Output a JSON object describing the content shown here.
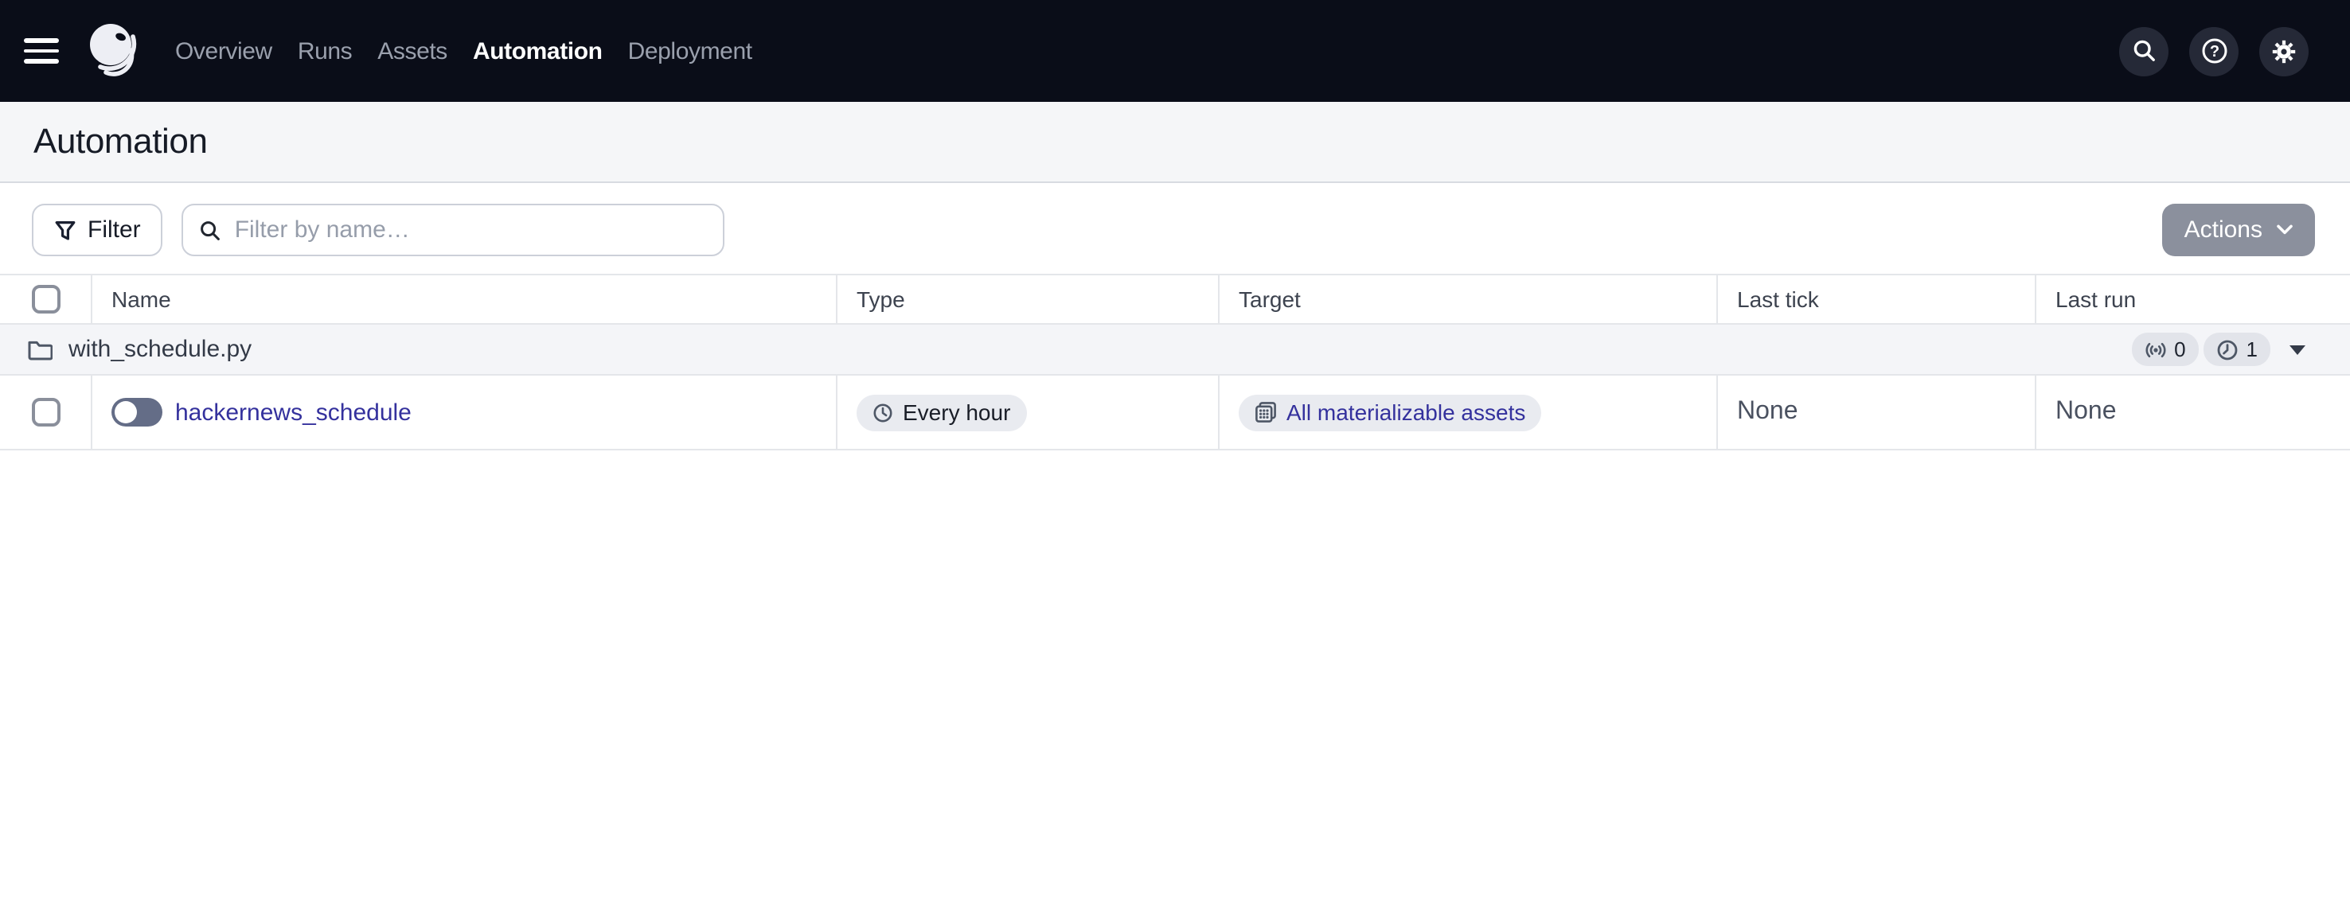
{
  "topbar": {
    "nav": [
      {
        "label": "Overview",
        "active": false
      },
      {
        "label": "Runs",
        "active": false
      },
      {
        "label": "Assets",
        "active": false
      },
      {
        "label": "Automation",
        "active": true
      },
      {
        "label": "Deployment",
        "active": false
      }
    ],
    "icons": [
      "hamburger-menu-icon",
      "dagster-logo",
      "search-icon",
      "help-icon",
      "settings-gear-icon"
    ],
    "help_glyph": "?"
  },
  "page": {
    "title": "Automation"
  },
  "toolbar": {
    "filter_button": "Filter",
    "search_placeholder": "Filter by name…",
    "search_value": "",
    "actions_button": "Actions"
  },
  "table": {
    "headers": [
      "Name",
      "Type",
      "Target",
      "Last tick",
      "Last run"
    ],
    "group_row": {
      "name": "with_schedule.py",
      "sensor_count": "0",
      "schedule_count": "1"
    },
    "rows": [
      {
        "name": "hackernews_schedule",
        "enabled": false,
        "type": "Every hour",
        "target": "All materializable assets",
        "last_tick": "None",
        "last_run": "None"
      }
    ]
  },
  "colors": {
    "topbar_bg": "#0a0d18",
    "link": "#34319d",
    "title_band_bg": "#f5f6f8",
    "group_row_bg": "#f4f5f8",
    "badge_bg": "#e9ebf0",
    "row_border": "#e4e6ea",
    "actions_button_bg": "#8b909d",
    "toggle_track": "#646d87"
  }
}
